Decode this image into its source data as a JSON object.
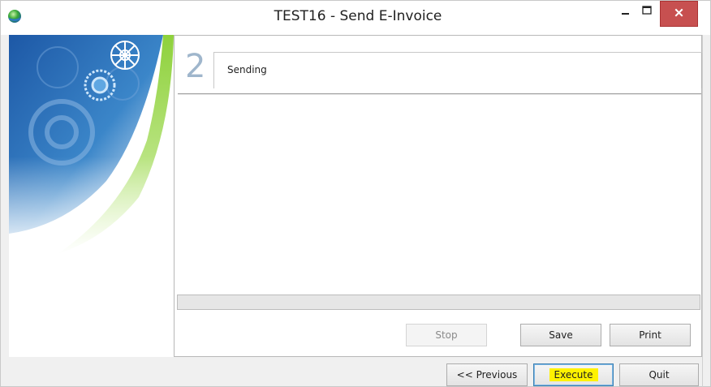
{
  "window": {
    "title": "TEST16 - Send E-Invoice",
    "app_icon": "globe-icon",
    "controls": [
      "minimize-icon",
      "maximize-icon",
      "close-icon"
    ]
  },
  "wizard": {
    "step_number": "2",
    "step_label": "Sending",
    "progress": 0
  },
  "panel_buttons": {
    "stop": "Stop",
    "save": "Save",
    "print": "Print"
  },
  "nav_buttons": {
    "previous": "<< Previous",
    "execute": "Execute",
    "quit": "Quit"
  },
  "colors": {
    "close_button": "#c75050",
    "step_number": "#9fb6cc",
    "highlight": "#fff200",
    "sidebar_blue": "#1e5fa8",
    "sidebar_green": "#8ed13b"
  }
}
